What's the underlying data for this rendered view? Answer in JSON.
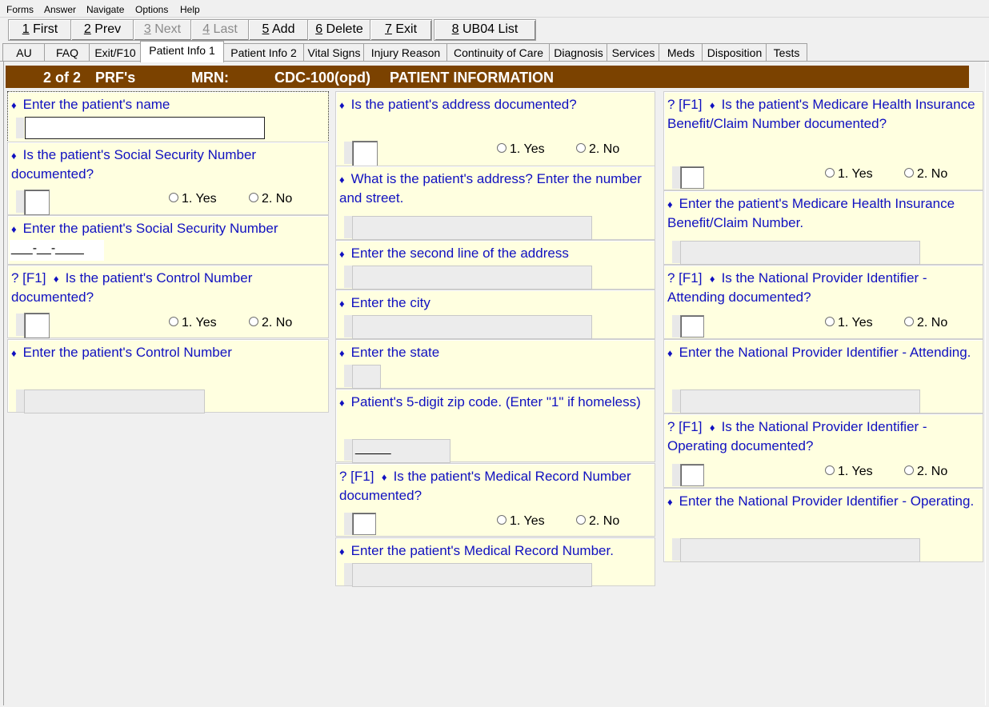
{
  "menu": [
    "Forms",
    "Answer",
    "Navigate",
    "Options",
    "Help"
  ],
  "toolbar": {
    "first": {
      "key": "1",
      "label": " First"
    },
    "prev": {
      "key": "2",
      "label": " Prev"
    },
    "next": {
      "key": "3",
      "label": " Next"
    },
    "last": {
      "key": "4",
      "label": " Last"
    },
    "add": {
      "key": "5",
      "label": " Add"
    },
    "delete": {
      "key": "6",
      "label": " Delete"
    },
    "exit": {
      "key": "7",
      "label": " Exit"
    },
    "ub04": {
      "key": "8",
      "label": " UB04 List"
    }
  },
  "tabs": [
    "AU",
    "FAQ",
    "Exit/F10",
    "Patient Info 1",
    "Patient Info 2",
    "Vital Signs",
    "Injury Reason",
    "Continuity of Care",
    "Diagnosis",
    "Services",
    "Meds",
    "Disposition",
    "Tests"
  ],
  "active_tab": "Patient Info 1",
  "header": {
    "record": "2 of 2",
    "prfs": "PRF's",
    "mrn_label": "MRN:",
    "mrn_value": "CDC-100(opd)",
    "section": "PATIENT INFORMATION"
  },
  "options": {
    "yes": "1. Yes",
    "no": "2. No"
  },
  "ssn_mask": "___-__-____",
  "zip_mask": "_____",
  "help_prefix": "? [F1]",
  "bullet": "♦",
  "questions": {
    "name": "Enter the patient's name",
    "ssn_doc": "Is the patient's Social Security Number documented?",
    "ssn": "Enter the patient's Social Security Number",
    "control_doc": "Is the patient's Control Number documented?",
    "control": "Enter the patient's Control Number",
    "addr_doc": "Is the patient's address documented?",
    "addr1": "What is the patient's address? Enter the number and street.",
    "addr2": "Enter the second line of the address",
    "city": "Enter the city",
    "state": "Enter the state",
    "zip": "Patient's 5-digit zip code. (Enter \"1\" if homeless)",
    "mrn_doc": "Is the patient's Medical Record Number documented?",
    "mrn": "Enter the patient's Medical Record Number.",
    "medicare_doc": "Is the patient's Medicare Health Insurance Benefit/Claim Number documented?",
    "medicare": "Enter the patient's Medicare Health Insurance Benefit/Claim Number.",
    "npi_att_doc": "Is the National Provider Identifier - Attending documented?",
    "npi_att": "Enter the National Provider Identifier - Attending.",
    "npi_op_doc": "Is the National Provider Identifier - Operating documented?",
    "npi_op": "Enter the National Provider Identifier - Operating."
  },
  "colors": {
    "header_bg": "#7b4200",
    "question_bg": "#ffffe0",
    "question_text": "#1010c0"
  }
}
